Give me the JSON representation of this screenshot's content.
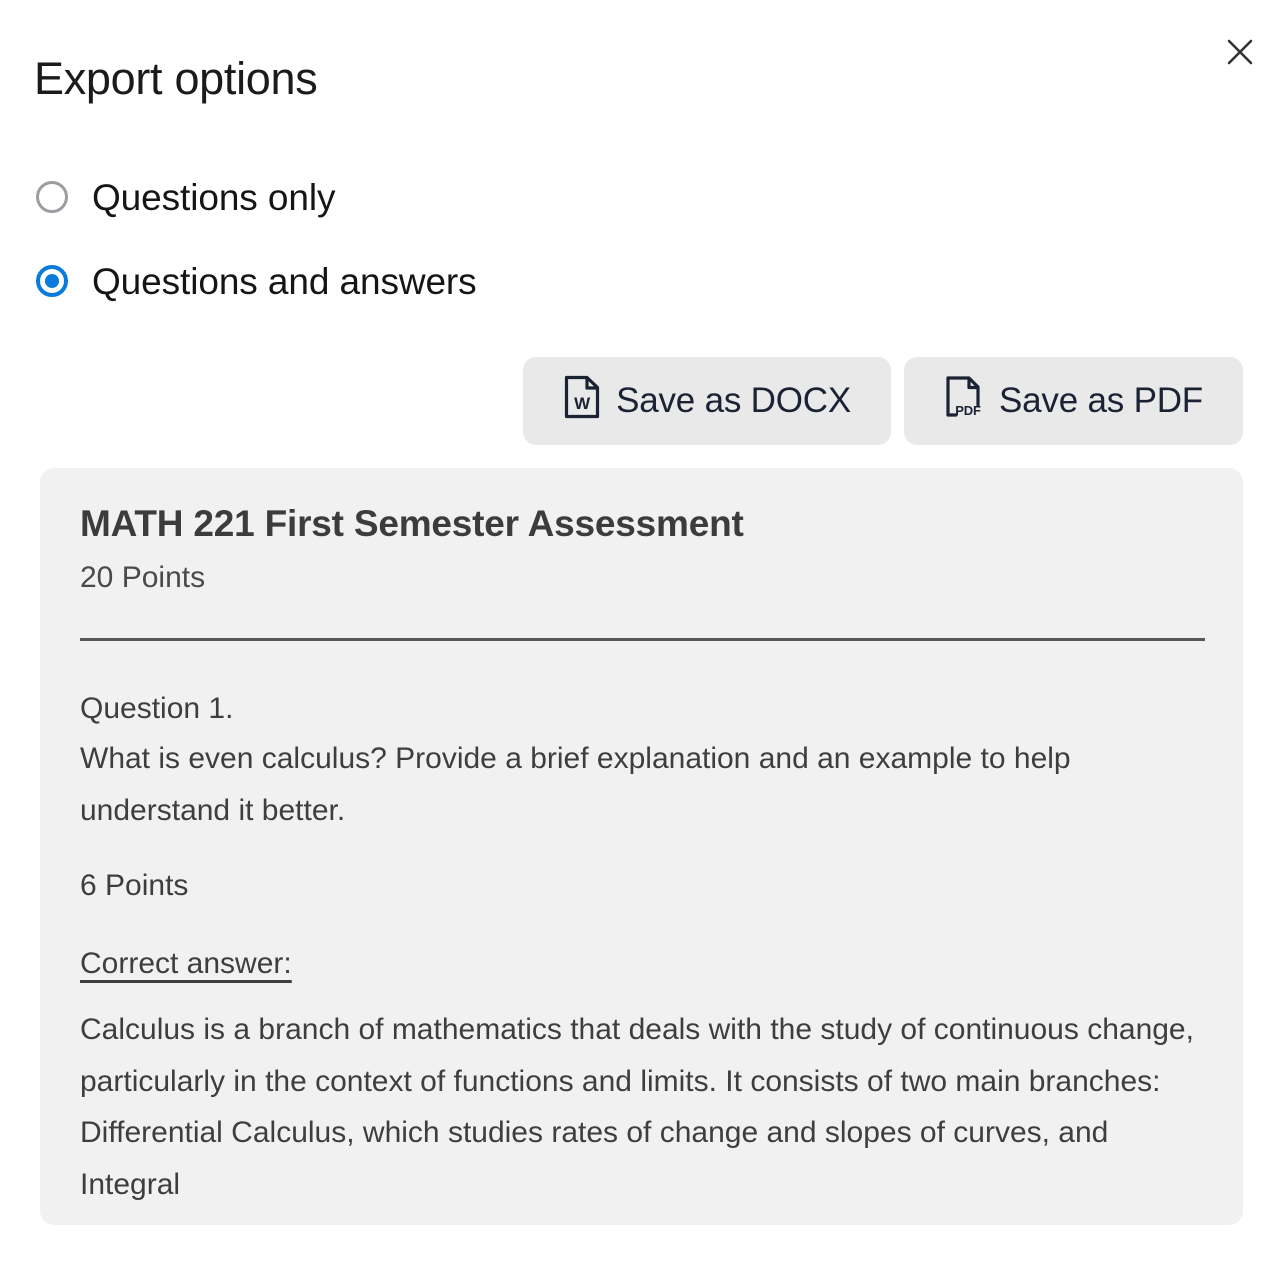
{
  "dialog": {
    "title": "Export options",
    "close_icon": "close-icon"
  },
  "export_options": {
    "selected": "Questions and answers",
    "items": [
      {
        "label": "Questions only",
        "selected": false
      },
      {
        "label": "Questions and answers",
        "selected": true
      }
    ]
  },
  "actions": {
    "docx": {
      "label": "Save as DOCX",
      "icon": "word-document-icon",
      "icon_text": "W"
    },
    "pdf": {
      "label": "Save as PDF",
      "icon": "pdf-document-icon",
      "icon_text": "PDF"
    }
  },
  "preview": {
    "doc_title": "MATH 221 First Semester Assessment",
    "doc_points": "20 Points",
    "question_label": "Question 1.",
    "question_text": "What is even calculus? Provide a brief explanation and an example to help understand it better.",
    "question_points": "6 Points",
    "answer_label": "Correct answer:",
    "answer_text": "Calculus is a branch of mathematics that deals with the study of continuous change, particularly in the context of functions and limits. It consists of two main branches: Differential Calculus, which studies rates of change and slopes of curves, and Integral"
  },
  "colors": {
    "accent": "#0a7bdb",
    "card_bg": "#f1f1f1",
    "button_bg": "#e9e9ea",
    "text": "#3e3e3e",
    "title": "#1b1b1b"
  }
}
